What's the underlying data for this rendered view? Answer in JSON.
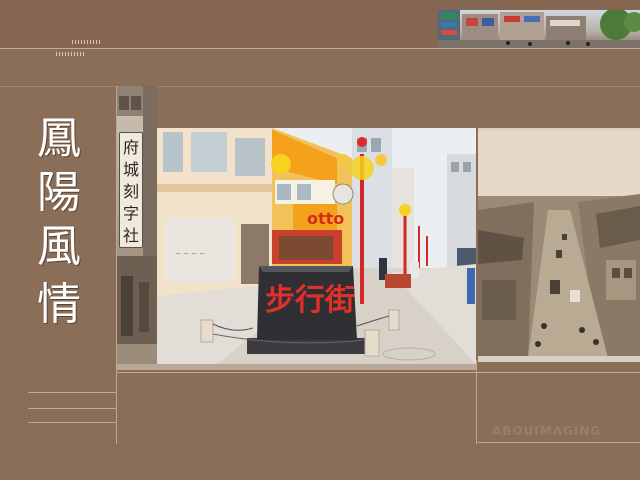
{
  "title": {
    "chars": [
      "鳳",
      "陽",
      "風",
      "情"
    ]
  },
  "signboard": {
    "chars": [
      "府",
      "城",
      "刻",
      "字",
      "社"
    ]
  },
  "street_sign": {
    "text": "步行街"
  },
  "shop_sign": {
    "text": "otto"
  },
  "watermark": {
    "text": "ABOUIMAGING"
  },
  "colors": {
    "background": "#8b6e58",
    "title_text": "#ffffff",
    "sign_text": "#e0302a",
    "storefront_orange": "#f4a21c"
  }
}
